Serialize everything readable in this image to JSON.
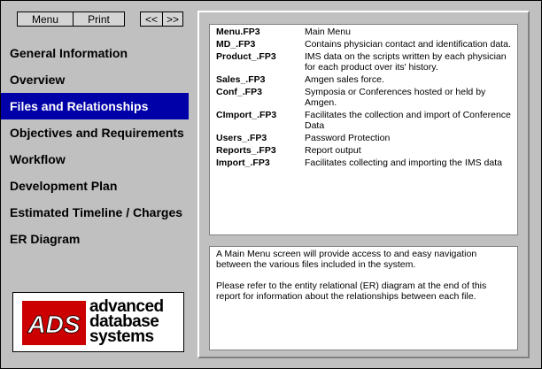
{
  "toolbar": {
    "menu_label": "Menu",
    "print_label": "Print",
    "back_label": "<<",
    "forward_label": ">>"
  },
  "nav": {
    "active_index": 2,
    "items": [
      {
        "label": "General Information"
      },
      {
        "label": "Overview"
      },
      {
        "label": "Files and Relationships"
      },
      {
        "label": "Objectives and Requirements"
      },
      {
        "label": "Workflow"
      },
      {
        "label": "Development Plan"
      },
      {
        "label": "Estimated Timeline / Charges"
      },
      {
        "label": "ER Diagram"
      }
    ]
  },
  "logo": {
    "mark_text": "ADS",
    "lines": [
      "advanced",
      "database",
      "systems"
    ],
    "mark_color": "#cc0000"
  },
  "files": [
    {
      "name": "Menu.FP3",
      "description": "Main Menu"
    },
    {
      "name": "MD_.FP3",
      "description": "Contains physician contact and identification data."
    },
    {
      "name": "Product_.FP3",
      "description": "IMS data on the scripts written by each physician for each product over its' history."
    },
    {
      "name": "Sales_.FP3",
      "description": "Amgen sales force."
    },
    {
      "name": "Conf_.FP3",
      "description": "Symposia or Conferences hosted or held by Amgen."
    },
    {
      "name": "CImport_.FP3",
      "description": "Facilitates the collection and import of Conference Data"
    },
    {
      "name": "Users_.FP3",
      "description": "Password Protection"
    },
    {
      "name": "Reports_.FP3",
      "description": "Report output"
    },
    {
      "name": "Import_.FP3",
      "description": "Facilitates collecting and importing the IMS data"
    }
  ],
  "description": {
    "paragraphs": [
      "A Main Menu screen will provide access to and easy navigation between the various files included in the system.",
      "Please refer to the entity relational (ER) diagram at the end of this report for information about the relationships between each file."
    ]
  }
}
